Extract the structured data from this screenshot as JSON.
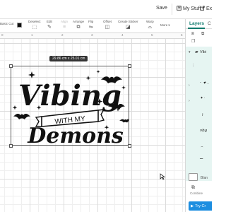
{
  "header": {
    "save_label": "Save",
    "my_stuff_label": "My Stuff",
    "export_label": "Ex",
    "my_stuff_icon": "bookmark-icon",
    "export_icon": "export-icon"
  },
  "toolbar": {
    "operation_label": "Basic Cut",
    "tools": [
      {
        "label": "Deselect",
        "icon": "deselect-icon"
      },
      {
        "label": "Edit",
        "icon": "edit-icon"
      },
      {
        "label": "Align",
        "icon": "align-icon"
      },
      {
        "label": "Arrange",
        "icon": "arrange-icon"
      },
      {
        "label": "Flip",
        "icon": "flip-icon"
      },
      {
        "label": "Offset",
        "icon": "offset-icon"
      },
      {
        "label": "Create Sticker",
        "icon": "sticker-icon"
      },
      {
        "label": "Warp",
        "icon": "warp-icon"
      },
      {
        "label": "More",
        "icon": "more-chevron-icon"
      }
    ],
    "color_swatch": "#111111"
  },
  "ruler": {
    "ticks": [
      "0",
      "1",
      "2",
      "3",
      "4",
      "5",
      "6"
    ]
  },
  "canvas": {
    "dimension_label": "29.86 cm x 25.01 cm",
    "design": {
      "line1": "Vibing",
      "line2": "WITH MY",
      "line3": "Demons"
    }
  },
  "layers_panel": {
    "tab_layers": "Layers",
    "tab_other": "C",
    "group_name": "Vibi",
    "blank_label": "Blan",
    "combine_label": "Combine",
    "try_button_label": "Try Cr"
  },
  "colors": {
    "accent": "#0e7a6c",
    "selection_bg": "#e6f5f2",
    "try_button": "#1c8ee0"
  }
}
